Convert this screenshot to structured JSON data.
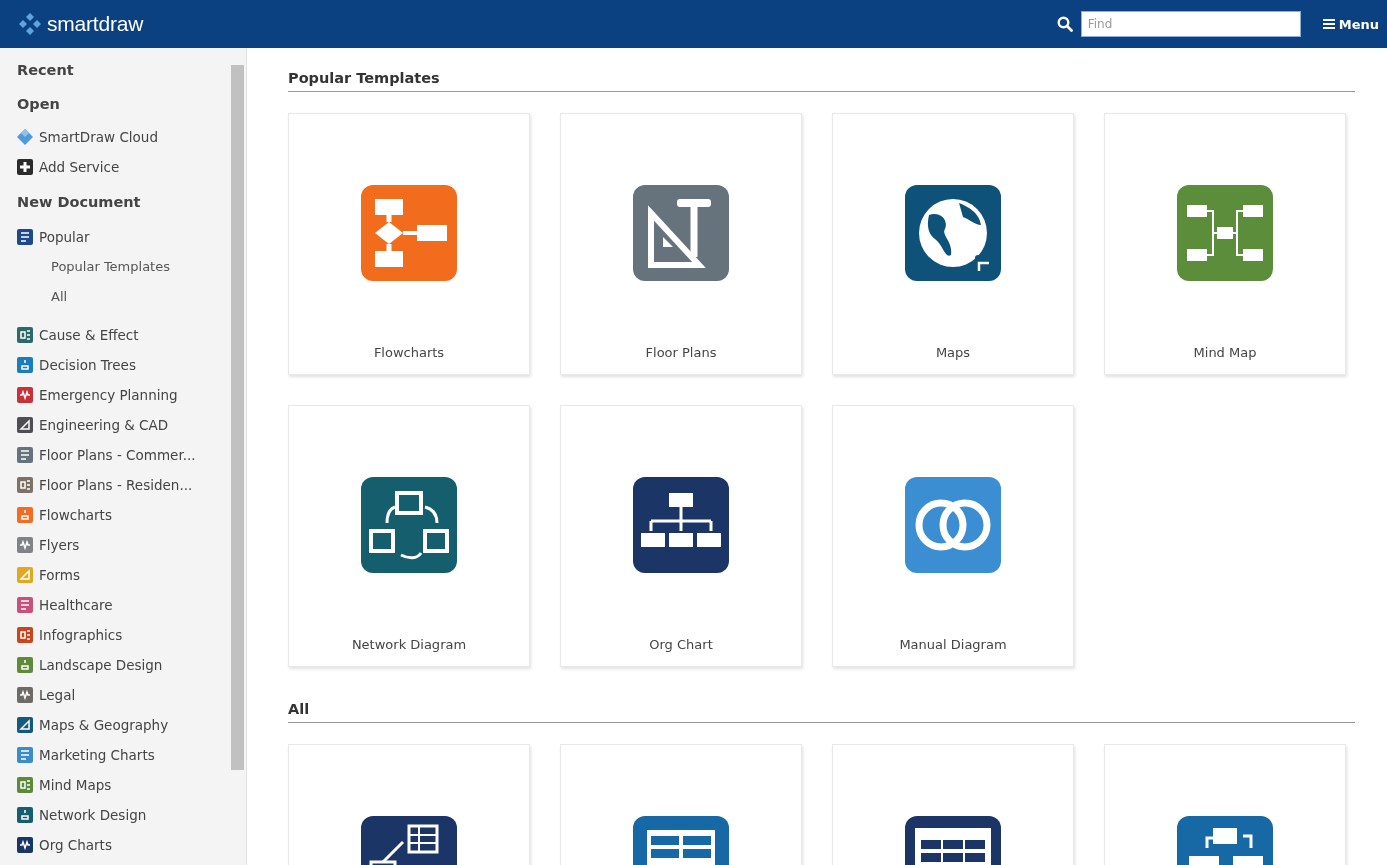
{
  "header": {
    "logo": "smartdraw",
    "search": {
      "placeholder": "Find"
    },
    "menu": "Menu"
  },
  "sidebar": {
    "sections": [
      {
        "title": "Recent"
      },
      {
        "title": "Open",
        "items": [
          {
            "label": "SmartDraw Cloud",
            "kind": "cloud"
          },
          {
            "label": "Add Service",
            "kind": "add"
          }
        ]
      },
      {
        "title": "New Document",
        "items": [
          {
            "label": "Popular",
            "kind": "category",
            "color": "#1d4a8c",
            "children": [
              {
                "label": "Popular Templates"
              },
              {
                "label": "All"
              }
            ]
          },
          {
            "label": "Cause & Effect",
            "kind": "category",
            "color": "#2b6a66"
          },
          {
            "label": "Decision Trees",
            "kind": "category",
            "color": "#1a7cc1"
          },
          {
            "label": "Emergency Planning",
            "kind": "category",
            "color": "#c8303a"
          },
          {
            "label": "Engineering & CAD",
            "kind": "category",
            "color": "#4d4f55"
          },
          {
            "label": "Floor Plans - Commer...",
            "kind": "category",
            "color": "#66737c"
          },
          {
            "label": "Floor Plans - Residen...",
            "kind": "category",
            "color": "#7c7266"
          },
          {
            "label": "Flowcharts",
            "kind": "category",
            "color": "#f26c21"
          },
          {
            "label": "Flyers",
            "kind": "category",
            "color": "#808285"
          },
          {
            "label": "Forms",
            "kind": "category",
            "color": "#e3a71f"
          },
          {
            "label": "Healthcare",
            "kind": "category",
            "color": "#c9507a"
          },
          {
            "label": "Infographics",
            "kind": "category",
            "color": "#c9461a"
          },
          {
            "label": "Landscape Design",
            "kind": "category",
            "color": "#5f8a3a"
          },
          {
            "label": "Legal",
            "kind": "category",
            "color": "#6e6a66"
          },
          {
            "label": "Maps & Geography",
            "kind": "category",
            "color": "#135a7c"
          },
          {
            "label": "Marketing Charts",
            "kind": "category",
            "color": "#3a8ccf"
          },
          {
            "label": "Mind Maps",
            "kind": "category",
            "color": "#5b8a3a"
          },
          {
            "label": "Network Design",
            "kind": "category",
            "color": "#145e6e"
          },
          {
            "label": "Org Charts",
            "kind": "category",
            "color": "#1b3566"
          }
        ]
      }
    ]
  },
  "sections": [
    {
      "title": "Popular Templates",
      "tiles": [
        {
          "label": "Flowcharts",
          "color": "#f26c1e"
        },
        {
          "label": "Floor Plans",
          "color": "#66737c"
        },
        {
          "label": "Maps",
          "color": "#0f5279"
        },
        {
          "label": "Mind Map",
          "color": "#5b8d3b"
        },
        {
          "label": "Network Diagram",
          "color": "#145e6e"
        },
        {
          "label": "Org Chart",
          "color": "#1b3566"
        },
        {
          "label": "Manual Diagram",
          "color": "#3b8ed1"
        }
      ]
    },
    {
      "title": "All",
      "tiles": [
        {
          "color": "#1b3566"
        },
        {
          "color": "#1769a6"
        },
        {
          "color": "#1b3566"
        },
        {
          "color": "#1769a6"
        }
      ]
    }
  ]
}
